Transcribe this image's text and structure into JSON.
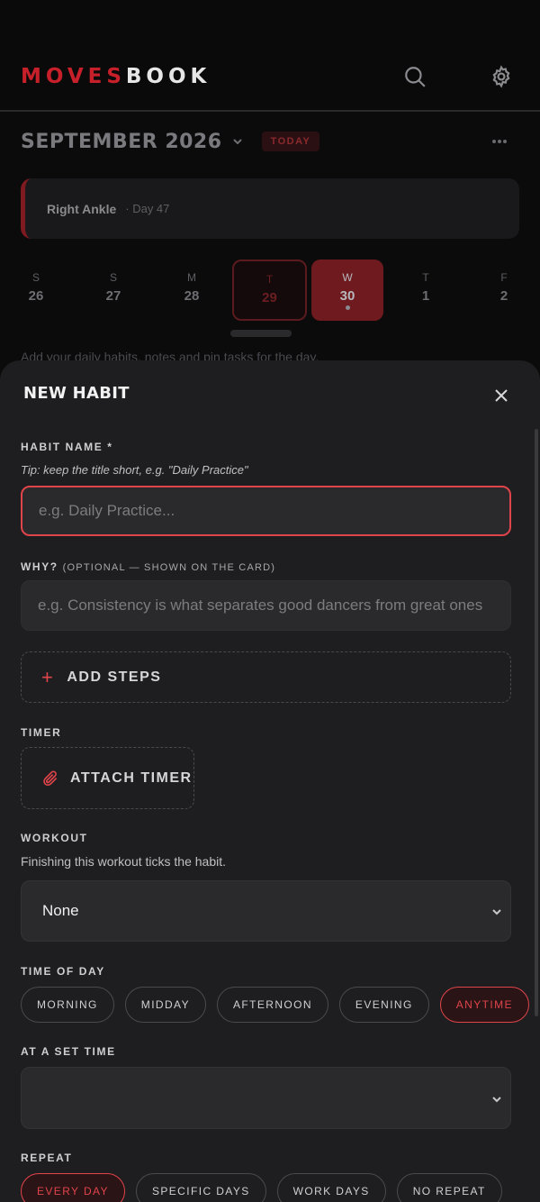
{
  "app": {
    "logo_part1": "MOVES",
    "logo_part2": "BOOK",
    "search_icon": "search-icon",
    "settings_icon": "gear-icon"
  },
  "calendar": {
    "month_label": "SEPTEMBER 2026",
    "today_label": "TODAY",
    "injury": {
      "name": "Right Ankle",
      "day": "· Day 47"
    },
    "days": [
      {
        "letter": "S",
        "num": "26"
      },
      {
        "letter": "S",
        "num": "27"
      },
      {
        "letter": "M",
        "num": "28"
      },
      {
        "letter": "T",
        "num": "29"
      },
      {
        "letter": "W",
        "num": "30"
      },
      {
        "letter": "T",
        "num": "1"
      },
      {
        "letter": "F",
        "num": "2"
      }
    ],
    "hint": "Add your daily habits, notes and pin tasks for the day."
  },
  "sheet": {
    "title": "NEW HABIT",
    "habit_name": {
      "label": "HABIT NAME *",
      "tip": "Tip: keep the title short, e.g. \"Daily Practice\"",
      "placeholder": "e.g. Daily Practice...",
      "value": ""
    },
    "why": {
      "label": "WHY?",
      "label_optional": "(OPTIONAL — SHOWN ON THE CARD)",
      "placeholder": "e.g. Consistency is what separates good dancers from great ones",
      "value": ""
    },
    "add_steps_label": "ADD STEPS",
    "timer": {
      "label": "TIMER",
      "attach_label": "ATTACH TIMER"
    },
    "workout": {
      "label": "WORKOUT",
      "subtitle": "Finishing this workout ticks the habit.",
      "selected": "None"
    },
    "time_of_day": {
      "label": "TIME OF DAY",
      "options": [
        "MORNING",
        "MIDDAY",
        "AFTERNOON",
        "EVENING",
        "ANYTIME"
      ],
      "selected": "ANYTIME"
    },
    "set_time": {
      "label": "AT A SET TIME",
      "selected": ""
    },
    "repeat": {
      "label": "REPEAT",
      "options": [
        "EVERY DAY",
        "SPECIFIC DAYS",
        "WORK DAYS",
        "NO REPEAT"
      ],
      "selected": "EVERY DAY"
    }
  },
  "colors": {
    "accent": "#e0444b",
    "brand_red": "#c8202a",
    "sheet_bg": "#1e1e20",
    "field_bg": "#2a2a2d"
  }
}
